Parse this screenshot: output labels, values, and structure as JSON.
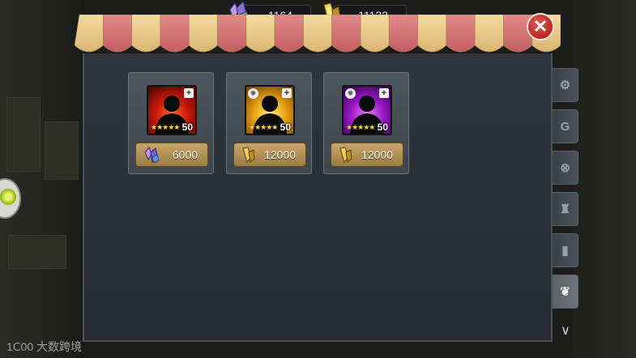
{
  "currencies": [
    {
      "name": "purple-crystal",
      "amount": "1164",
      "color": "#8a6fd8"
    },
    {
      "name": "gold-crystal",
      "amount": "11133",
      "color": "#e8c040"
    }
  ],
  "shop_items": [
    {
      "frame": "red",
      "level": "50",
      "stars": "★★★★★",
      "price": "6000",
      "currency_icon": "purple-crystal"
    },
    {
      "frame": "gold",
      "level": "50",
      "stars": "★★★★★",
      "price": "12000",
      "currency_icon": "gold-crystal"
    },
    {
      "frame": "purple",
      "level": "50",
      "stars": "★★★★★",
      "price": "12000",
      "currency_icon": "gold-crystal"
    }
  ],
  "tabs": [
    {
      "icon": "gear-tab-icon",
      "glyph": "⚙",
      "active": false
    },
    {
      "icon": "g-tab-icon",
      "glyph": "G",
      "active": false
    },
    {
      "icon": "crossed-circle-tab-icon",
      "glyph": "⊗",
      "active": false
    },
    {
      "icon": "medal-tab-icon",
      "glyph": "♜",
      "active": false
    },
    {
      "icon": "mug-tab-icon",
      "glyph": "▮",
      "active": false
    },
    {
      "icon": "seeds-tab-icon",
      "glyph": "❦",
      "active": true
    }
  ],
  "close_icon": "✕",
  "scroll_icon": "∨",
  "watermark": "大数跨境",
  "watermark_logo": "1Ⅽ00"
}
